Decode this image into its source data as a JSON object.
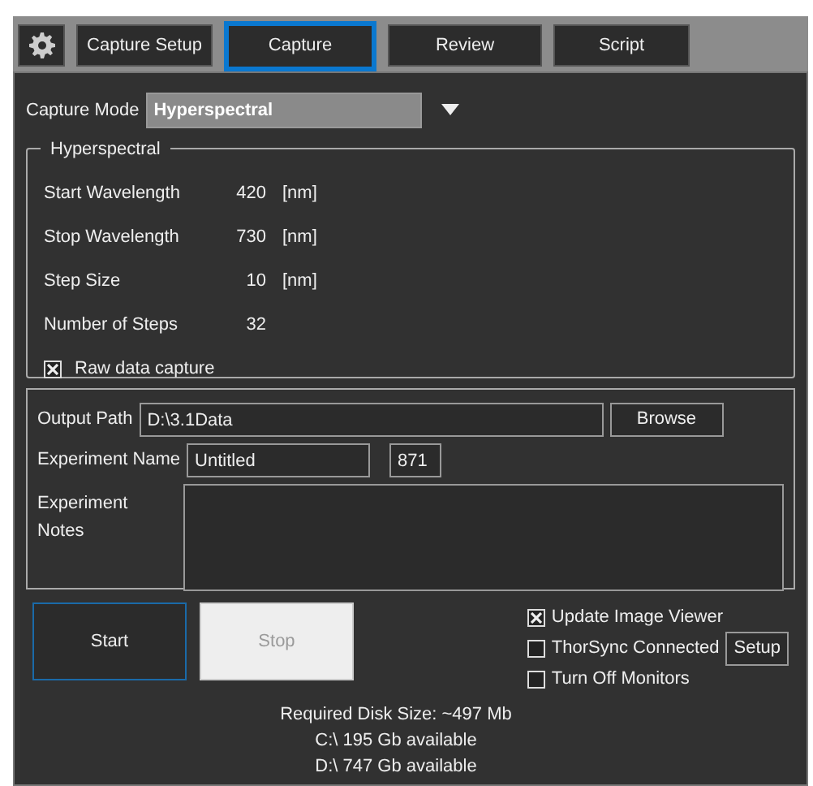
{
  "tabs": [
    {
      "label": "Capture Setup",
      "selected": false
    },
    {
      "label": "Capture",
      "selected": true
    },
    {
      "label": "Review",
      "selected": false
    },
    {
      "label": "Script",
      "selected": false
    }
  ],
  "capture_mode": {
    "label": "Capture Mode",
    "value": "Hyperspectral"
  },
  "hyperspectral": {
    "title": "Hyperspectral",
    "params": [
      {
        "label": "Start Wavelength",
        "value": "420",
        "unit": "[nm]"
      },
      {
        "label": "Stop Wavelength",
        "value": "730",
        "unit": "[nm]"
      },
      {
        "label": "Step Size",
        "value": "10",
        "unit": "[nm]"
      },
      {
        "label": "Number of Steps",
        "value": "32"
      }
    ],
    "raw_data_capture": {
      "label": "Raw data capture",
      "checked": true
    }
  },
  "output": {
    "path_label": "Output Path",
    "path": "D:\\3.1Data",
    "browse": "Browse",
    "name_label": "Experiment Name",
    "name": "Untitled",
    "number": "871",
    "notes_label": "Experiment Notes"
  },
  "buttons": [
    {
      "label": "Start",
      "disabled": false
    },
    {
      "label": "Stop",
      "disabled": true
    }
  ],
  "options": [
    {
      "label": "Update Image Viewer",
      "checked": true
    },
    {
      "label": "ThorSync Connected",
      "checked": false,
      "button": "Setup"
    },
    {
      "label": "Turn Off Monitors",
      "checked": false
    }
  ],
  "disk_info": [
    "Required Disk Size: ~497 Mb",
    "C:\\ 195 Gb available",
    "D:\\ 747 Gb available"
  ]
}
